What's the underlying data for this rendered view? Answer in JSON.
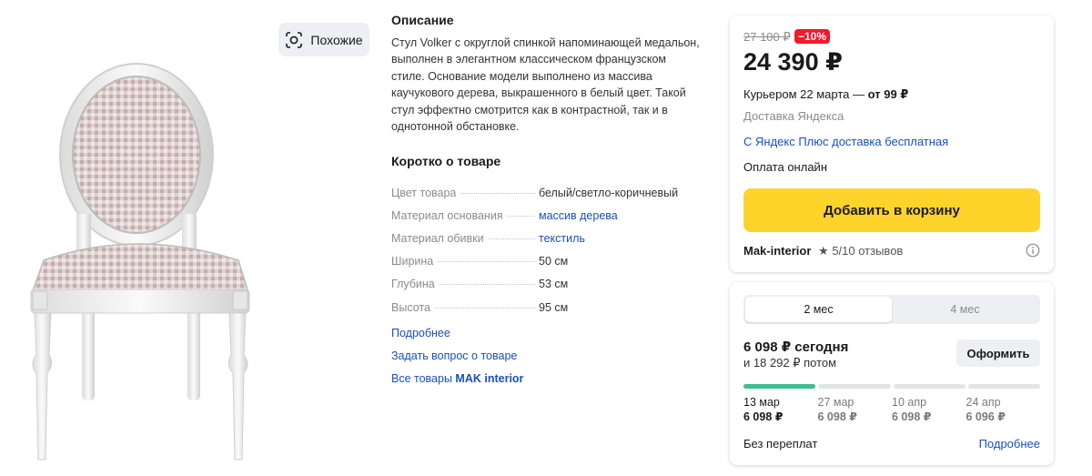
{
  "similar": {
    "label": "Похожие"
  },
  "description": {
    "heading": "Описание",
    "text": "Стул Volker с округлой спинкой напоминающей медальон, выполнен в элегантном классическом французском стиле. Основание модели выполнено из массива каучукового дерева, выкрашенного в белый цвет. Такой стул эффектно смотрится как в контрастной, так и в однотонной обстановке."
  },
  "short": {
    "heading": "Коротко о товаре",
    "specs": [
      {
        "name": "Цвет товара",
        "value": "белый/светло-коричневый"
      },
      {
        "name": "Материал основания",
        "value": "массив дерева"
      },
      {
        "name": "Материал обивки",
        "value": "текстиль"
      },
      {
        "name": "Ширина",
        "value": "50 см"
      },
      {
        "name": "Глубина",
        "value": "53 см"
      },
      {
        "name": "Высота",
        "value": "95 см"
      }
    ]
  },
  "links": {
    "more": "Подробнее",
    "ask": "Задать вопрос о товаре",
    "all_prefix": "Все товары",
    "all_brand": "MAK interior"
  },
  "price_card": {
    "old_price": "27 100 ₽",
    "discount": "−10%",
    "price": "24 390 ₽",
    "delivery_text": "Курьером 22 марта — ",
    "delivery_price": "от 99 ₽",
    "delivery_source": "Доставка Яндекса",
    "plus_text": "С Яндекс Плюс доставка бесплатная",
    "payment": "Оплата онлайн",
    "cart_button": "Добавить в корзину",
    "seller": "Mak-interior",
    "rating_star": "★",
    "rating_value": "5",
    "rating_reviews": "/10 отзывов"
  },
  "installment": {
    "tabs": [
      "2 мес",
      "4 мес"
    ],
    "active_tab": 0,
    "today": "6 098 ₽ сегодня",
    "later": "и 18 292 ₽ потом",
    "order_button": "Оформить",
    "payments": [
      {
        "date": "13 мар",
        "amount": "6 098 ₽"
      },
      {
        "date": "27 мар",
        "amount": "6 098 ₽"
      },
      {
        "date": "10 апр",
        "amount": "6 098 ₽"
      },
      {
        "date": "24 апр",
        "amount": "6 096 ₽"
      }
    ],
    "no_overpay": "Без переплат",
    "more": "Подробнее"
  },
  "colors": {
    "accent_yellow": "#fed42b",
    "discount_red": "#f2192c",
    "link_blue": "#1a4fbf",
    "progress_green": "#3ac08e"
  }
}
